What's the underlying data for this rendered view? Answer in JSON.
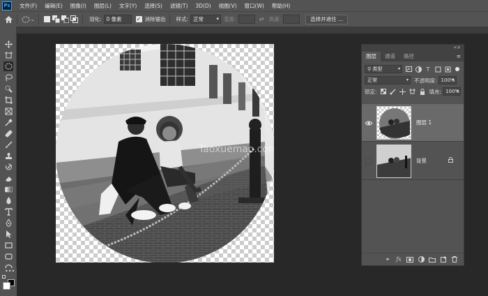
{
  "app": {
    "logo": "Ps"
  },
  "menu": [
    "文件(F)",
    "编辑(E)",
    "图像(I)",
    "图层(L)",
    "文字(Y)",
    "选择(S)",
    "滤镜(T)",
    "3D(D)",
    "视图(V)",
    "窗口(W)",
    "帮助(H)"
  ],
  "options": {
    "feather_label": "羽化:",
    "feather_value": "0 像素",
    "antialias_label": "消除锯齿",
    "antialias_checked": true,
    "style_label": "样式:",
    "style_value": "正常",
    "width_label": "宽度:",
    "height_label": "高度:",
    "select_mask_button": "选择并遮住 ..."
  },
  "canvas": {
    "watermark": "Taoxuemao.com"
  },
  "layers_panel": {
    "tabs": [
      "图层",
      "通道",
      "路径"
    ],
    "active_tab": 0,
    "filter_kind": "类型",
    "blend_mode": "正常",
    "opacity_label": "不透明度:",
    "opacity_value": "100%",
    "lock_label": "锁定:",
    "fill_label": "填充:",
    "fill_value": "100%",
    "layers": [
      {
        "name": "图层 1",
        "visible": true,
        "selected": true,
        "locked": false
      },
      {
        "name": "背景",
        "visible": false,
        "selected": false,
        "locked": true
      }
    ]
  },
  "colors": {
    "ui_gray": "#535353",
    "canvas_bg": "#282828",
    "accent_blue": "#31a8ff"
  }
}
